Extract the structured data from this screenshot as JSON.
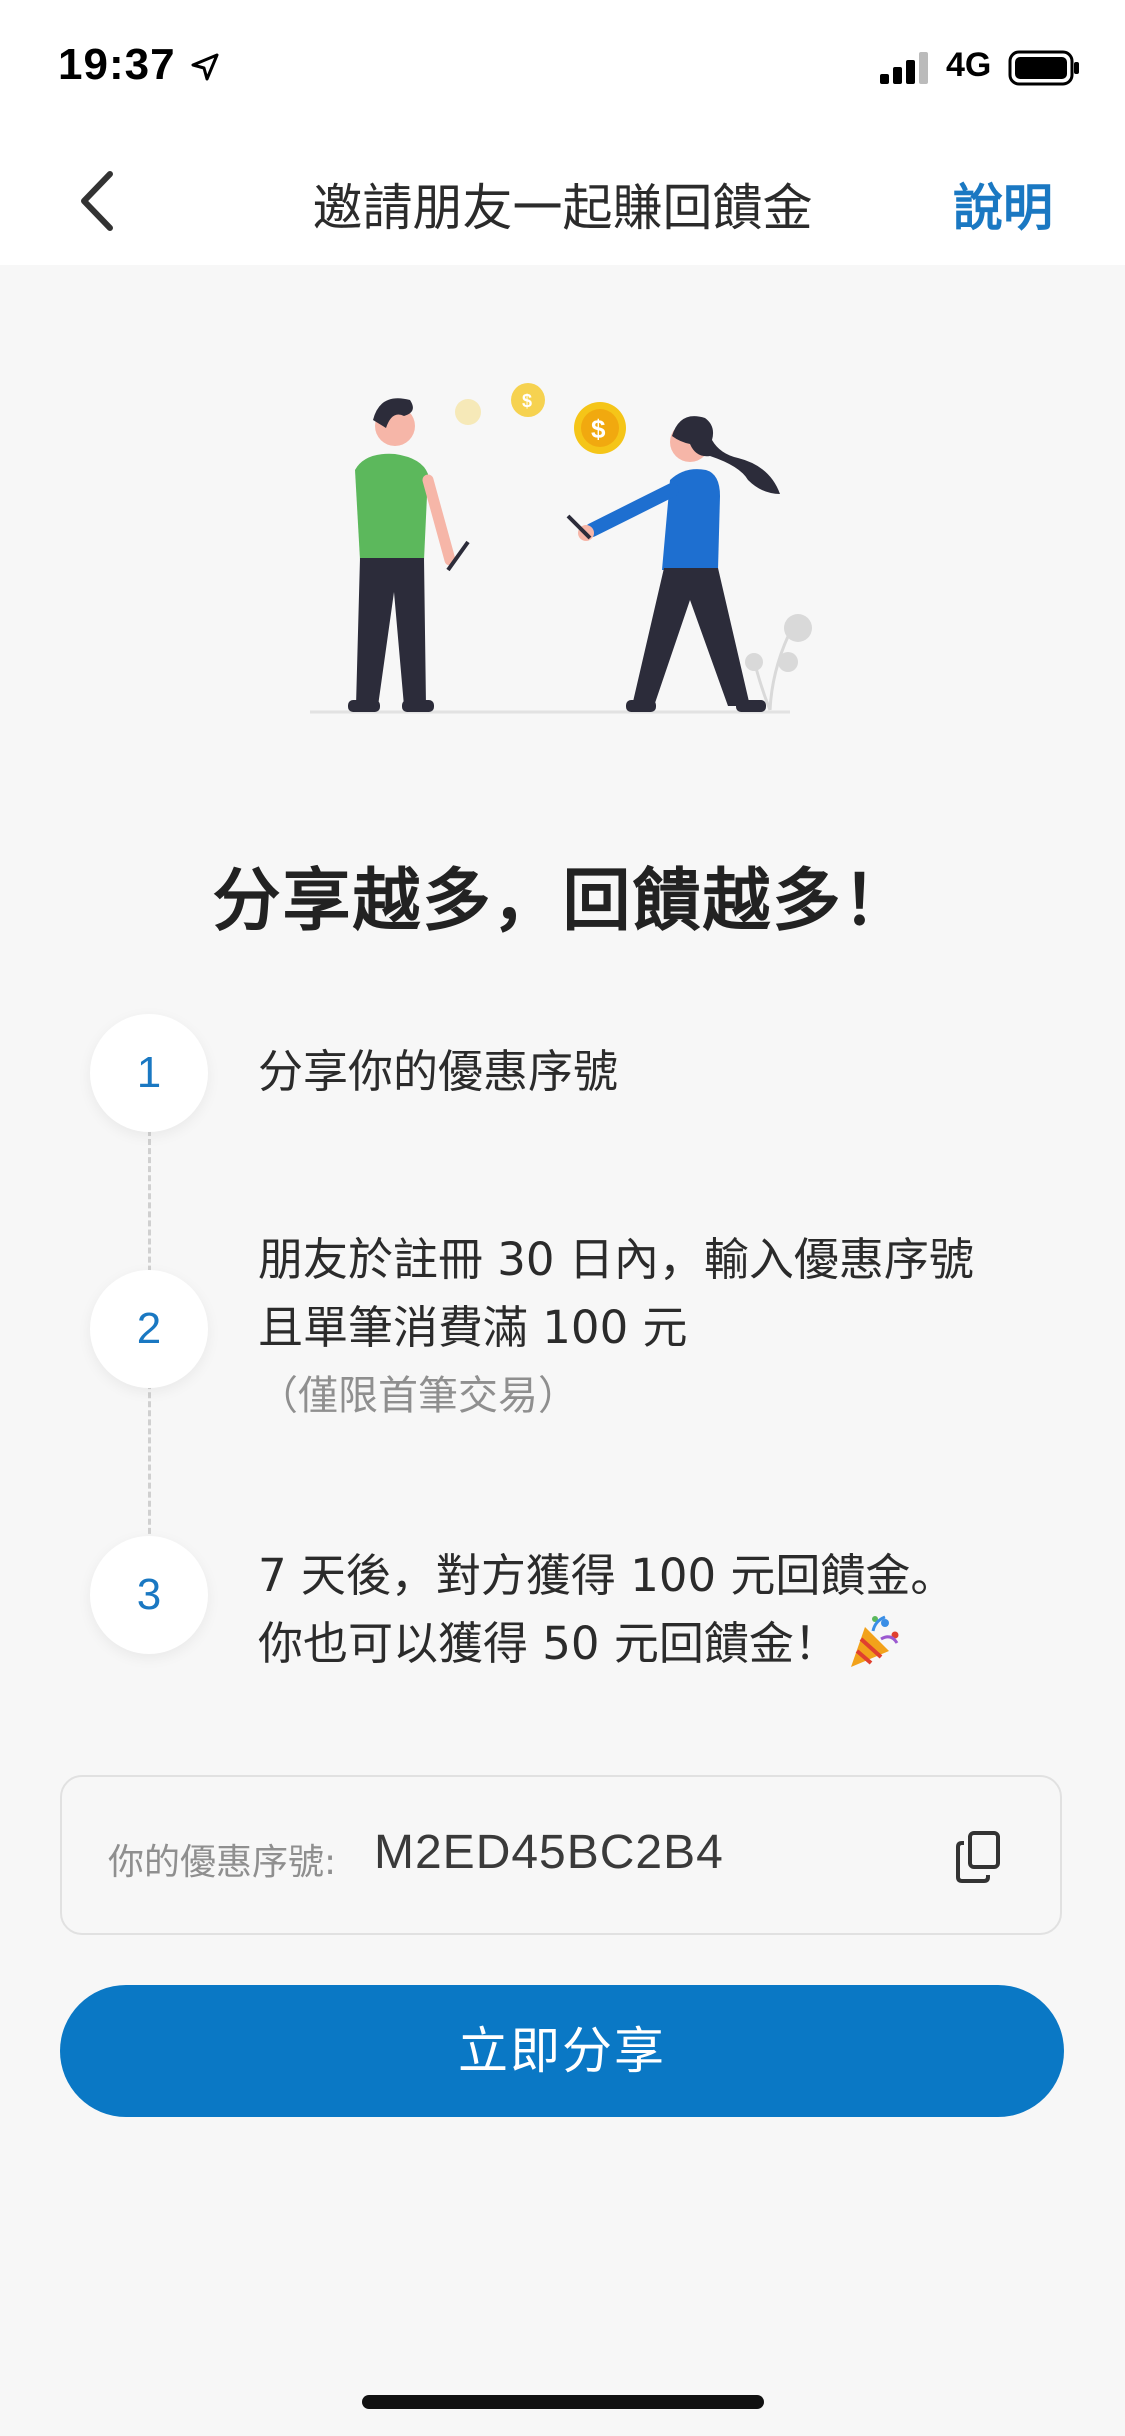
{
  "status_bar": {
    "time": "19:37",
    "network": "4G"
  },
  "nav": {
    "title": "邀請朋友一起賺回饋金",
    "help_label": "說明"
  },
  "headline": "分享越多，回饋越多！",
  "steps": [
    {
      "number": "1",
      "lines": [
        "分享你的優惠序號"
      ]
    },
    {
      "number": "2",
      "lines": [
        "朋友於註冊 30 日內，輸入優惠序號",
        "且單筆消費滿 100 元"
      ],
      "note": "（僅限首筆交易）"
    },
    {
      "number": "3",
      "lines": [
        "7 天後，對方獲得 100 元回饋金。",
        "你也可以獲得 50 元回饋金！"
      ]
    }
  ],
  "promo": {
    "label": "你的優惠序號:",
    "code": "M2ED45BC2B4"
  },
  "share_button_label": "立即分享",
  "colors": {
    "accent": "#1a78c2",
    "button": "#0a78c5",
    "background": "#f7f7f7",
    "illustration_green": "#5cb85c",
    "illustration_blue": "#1e6fd0",
    "coin": "#f5c518"
  },
  "icons": {
    "back": "chevron-left-icon",
    "copy": "copy-icon",
    "location": "location-arrow-icon",
    "signal": "cellular-signal-icon",
    "battery": "battery-icon",
    "party": "party-popper-icon"
  }
}
